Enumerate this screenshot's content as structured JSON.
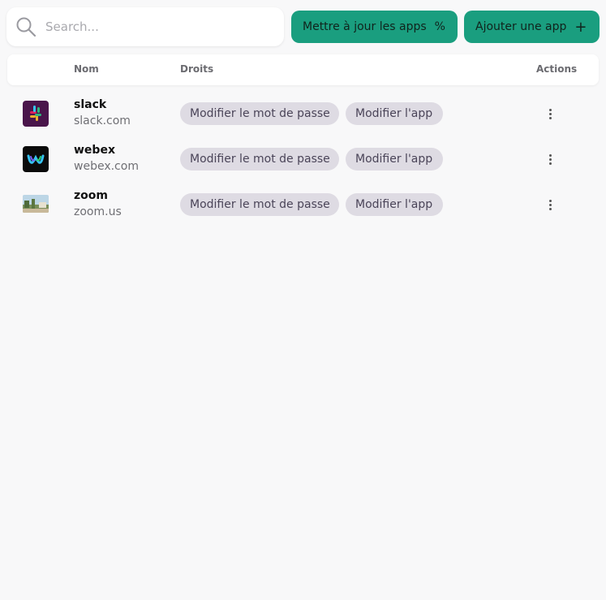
{
  "search": {
    "placeholder": "Search..."
  },
  "toolbar": {
    "update_label": "Mettre à jour les apps",
    "update_icon": "percent-icon",
    "add_label": "Ajouter une app",
    "add_icon": "plus-icon"
  },
  "table": {
    "columns": {
      "name": "Nom",
      "rights": "Droits",
      "actions": "Actions"
    },
    "rows": [
      {
        "name": "slack",
        "domain": "slack.com",
        "rights": [
          "Modifier le mot de passe",
          "Modifier l'app"
        ]
      },
      {
        "name": "webex",
        "domain": "webex.com",
        "rights": [
          "Modifier le mot de passe",
          "Modifier l'app"
        ]
      },
      {
        "name": "zoom",
        "domain": "zoom.us",
        "rights": [
          "Modifier le mot de passe",
          "Modifier l'app"
        ]
      }
    ]
  },
  "colors": {
    "primary_button": "#1a9e7f",
    "chip_background": "#dedbe3",
    "page_background": "#f8f8f9"
  }
}
